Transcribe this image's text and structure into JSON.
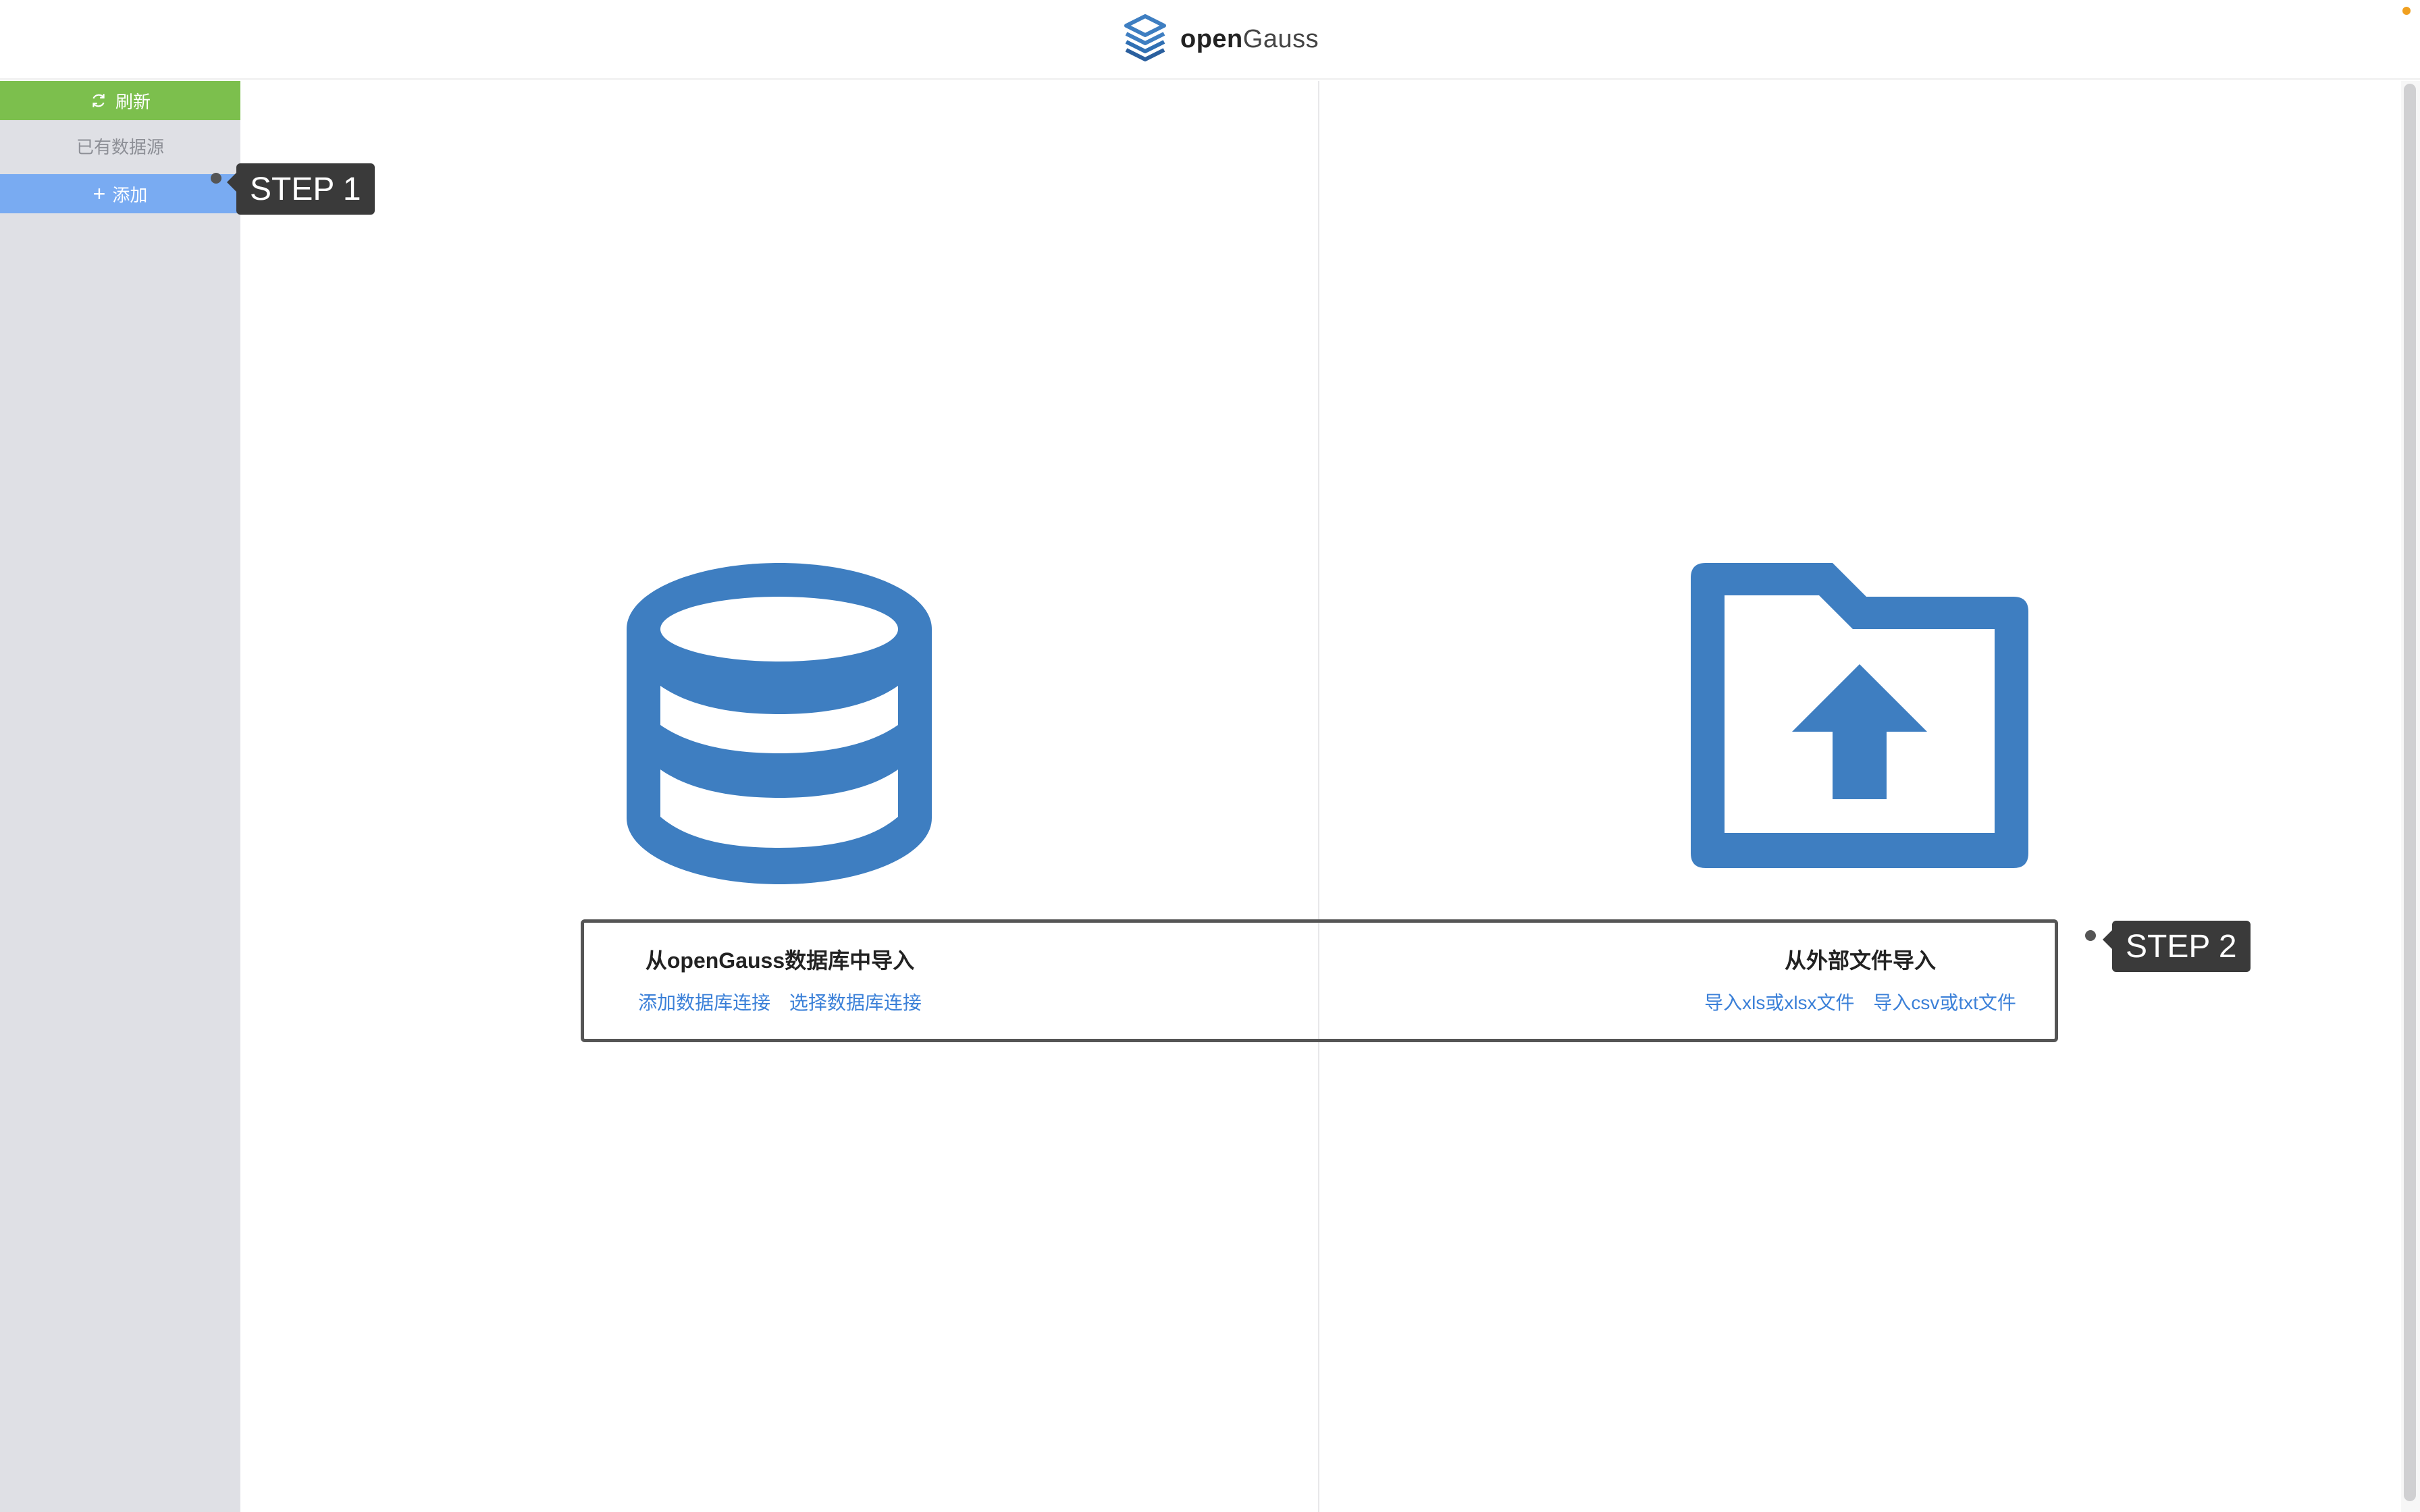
{
  "header": {
    "brand_open": "open",
    "brand_gauss": "Gauss",
    "logo_icon": "opengauss-layers-icon"
  },
  "sidebar": {
    "refresh_label": "刷新",
    "refresh_icon": "refresh-icon",
    "heading": "已有数据源",
    "add_label": "添加",
    "add_icon": "plus-icon",
    "colors": {
      "refresh_bg": "#7cbf4d",
      "add_bg": "#79abf2",
      "sidebar_bg": "#dfe0e5"
    }
  },
  "main": {
    "left": {
      "icon": "database-icon",
      "title": "从openGauss数据库中导入",
      "links": [
        "添加数据库连接",
        "选择数据库连接"
      ]
    },
    "right": {
      "icon": "folder-upload-icon",
      "title": "从外部文件导入",
      "links": [
        "导入xls或xlsx文件",
        "导入csv或txt文件"
      ]
    },
    "accent_color": "#3e7ec1",
    "link_color": "#3b80d8"
  },
  "tooltips": {
    "step1": "STEP 1",
    "step2": "STEP 2"
  }
}
